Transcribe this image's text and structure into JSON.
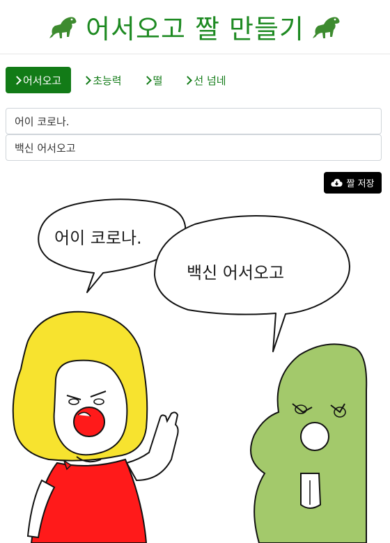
{
  "header": {
    "title": "어서오고 짤 만들기",
    "icon": "dinosaur-icon",
    "title_color": "#1e8a22"
  },
  "tabs": [
    {
      "label": "어서오고",
      "active": true
    },
    {
      "label": "초능력",
      "active": false
    },
    {
      "label": "떨",
      "active": false
    },
    {
      "label": "선 넘네",
      "active": false
    }
  ],
  "inputs": {
    "line1": "어이 코로나.",
    "line2": "백신 어서오고"
  },
  "save_button": {
    "label": "짤 저장",
    "icon": "cloud-download-icon"
  },
  "comic": {
    "bubble1_text": "어이 코로나.",
    "bubble2_text": "백신 어서오고"
  },
  "colors": {
    "accent": "#127b17",
    "girl_hair": "#f7e32f",
    "girl_dress": "#ff1a1a",
    "dino_body": "#a3c96b"
  }
}
